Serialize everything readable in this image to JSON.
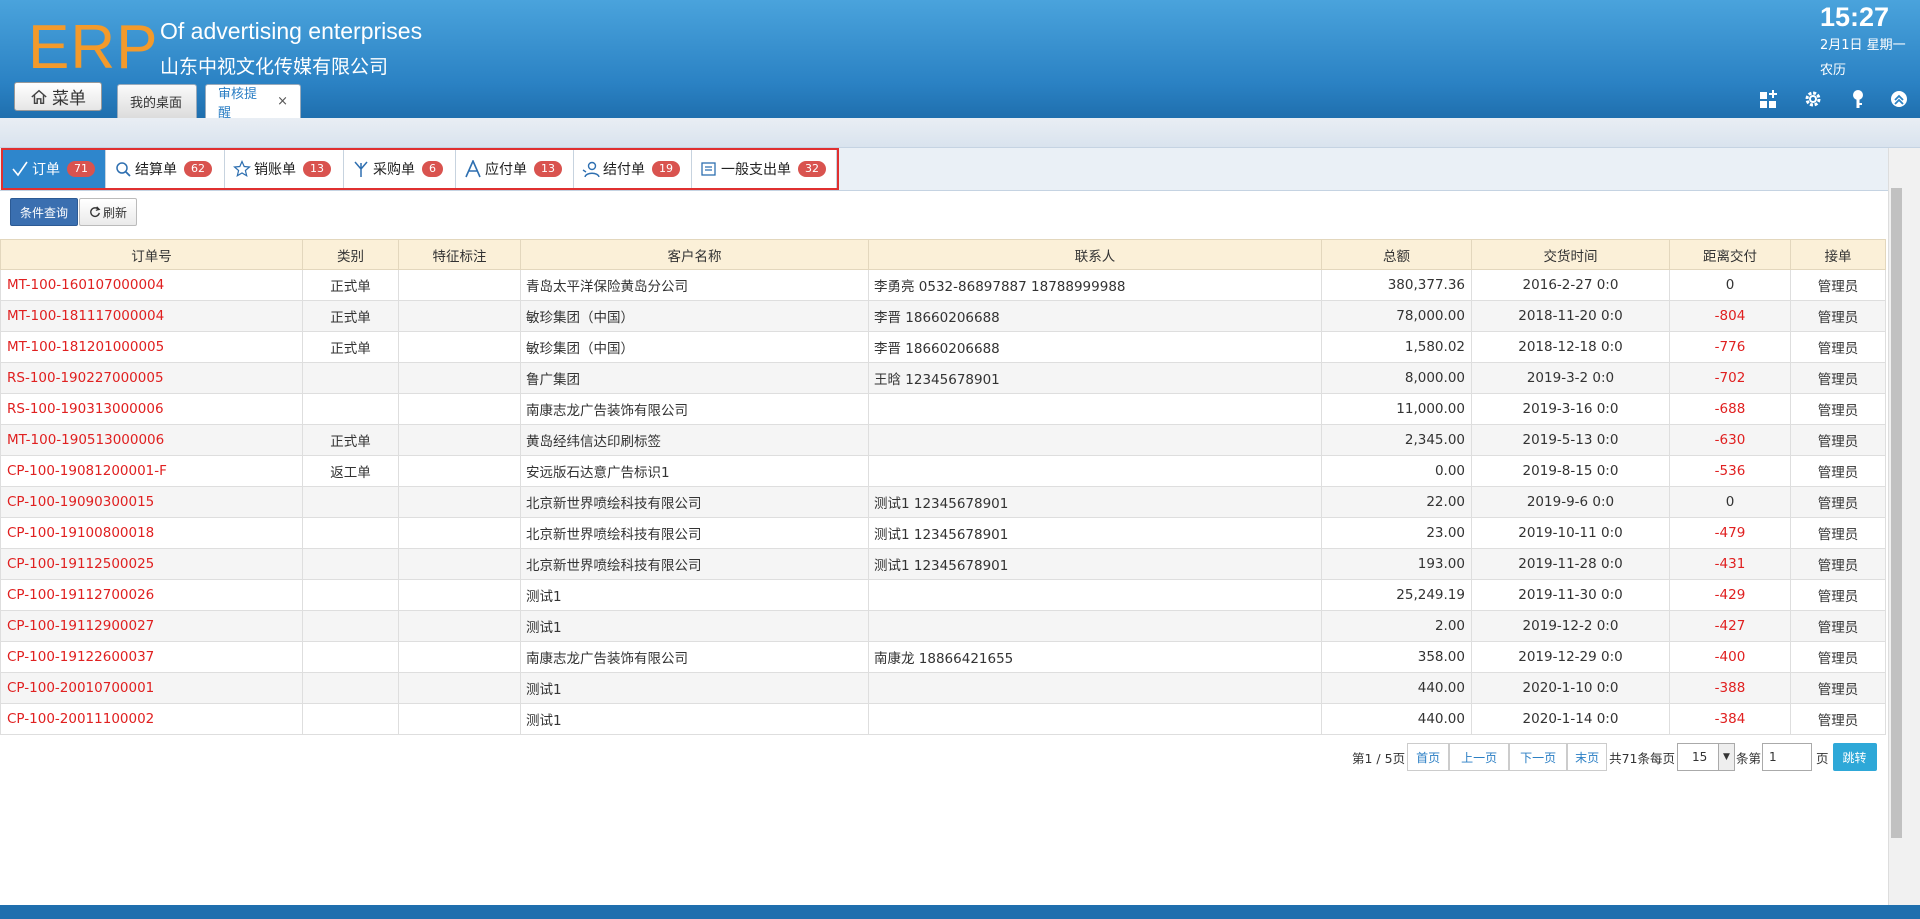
{
  "header": {
    "logo": "ERP",
    "brand_en": "Of advertising enterprises",
    "brand_cn": "山东中视文化传媒有限公司",
    "menu_label": "菜单",
    "tabs": [
      {
        "label": "我的桌面"
      },
      {
        "label": "审核提醒",
        "close": "×"
      }
    ],
    "clock": "15:27",
    "date": "2月1日 星期一",
    "lunar": "农历",
    "icons": [
      "grid-add-icon",
      "gear-icon",
      "key-icon",
      "collapse-up-icon"
    ]
  },
  "doc_tabs": [
    {
      "label": "订单",
      "count": "71",
      "icon": "check-icon",
      "active": true
    },
    {
      "label": "结算单",
      "count": "62",
      "icon": "search-icon"
    },
    {
      "label": "销账单",
      "count": "13",
      "icon": "star-icon"
    },
    {
      "label": "采购单",
      "count": "6",
      "icon": "fork-icon"
    },
    {
      "label": "应付单",
      "count": "13",
      "icon": "letter-a-icon"
    },
    {
      "label": "结付单",
      "count": "19",
      "icon": "person-icon"
    },
    {
      "label": "一般支出单",
      "count": "32",
      "icon": "document-icon"
    }
  ],
  "toolbar": {
    "query": "条件查询",
    "refresh": "刷新"
  },
  "table": {
    "columns": [
      "订单号",
      "类别",
      "特征标注",
      "客户名称",
      "联系人",
      "总额",
      "交货时间",
      "距离交付",
      "接单"
    ],
    "rows": [
      [
        "MT-100-160107000004",
        "正式单",
        "",
        "青岛太平洋保险黄岛分公司",
        "李勇亮 0532-86897887 18788999988",
        "380,377.36",
        "2016-2-27 0:0",
        "0",
        "管理员"
      ],
      [
        "MT-100-181117000004",
        "正式单",
        "",
        "敏珍集团（中国）",
        "李晋 18660206688",
        "78,000.00",
        "2018-11-20 0:0",
        "-804",
        "管理员"
      ],
      [
        "MT-100-181201000005",
        "正式单",
        "",
        "敏珍集团（中国）",
        "李晋 18660206688",
        "1,580.02",
        "2018-12-18 0:0",
        "-776",
        "管理员"
      ],
      [
        "RS-100-190227000005",
        "",
        "",
        "鲁广集团",
        "王晗 12345678901",
        "8,000.00",
        "2019-3-2 0:0",
        "-702",
        "管理员"
      ],
      [
        "RS-100-190313000006",
        "",
        "",
        "南康志龙广告装饰有限公司",
        "",
        "11,000.00",
        "2019-3-16 0:0",
        "-688",
        "管理员"
      ],
      [
        "MT-100-190513000006",
        "正式单",
        "",
        "黄岛经纬信达印刷标签",
        "",
        "2,345.00",
        "2019-5-13 0:0",
        "-630",
        "管理员"
      ],
      [
        "CP-100-19081200001-F",
        "返工单",
        "",
        "安远版石达意广告标识1",
        "",
        "0.00",
        "2019-8-15 0:0",
        "-536",
        "管理员"
      ],
      [
        "CP-100-19090300015",
        "",
        "",
        "北京新世界喷绘科技有限公司",
        "测试1 12345678901",
        "22.00",
        "2019-9-6 0:0",
        "0",
        "管理员"
      ],
      [
        "CP-100-19100800018",
        "",
        "",
        "北京新世界喷绘科技有限公司",
        "测试1 12345678901",
        "23.00",
        "2019-10-11 0:0",
        "-479",
        "管理员"
      ],
      [
        "CP-100-19112500025",
        "",
        "",
        "北京新世界喷绘科技有限公司",
        "测试1 12345678901",
        "193.00",
        "2019-11-28 0:0",
        "-431",
        "管理员"
      ],
      [
        "CP-100-19112700026",
        "",
        "",
        "测试1",
        "",
        "25,249.19",
        "2019-11-30 0:0",
        "-429",
        "管理员"
      ],
      [
        "CP-100-19112900027",
        "",
        "",
        "测试1",
        "",
        "2.00",
        "2019-12-2 0:0",
        "-427",
        "管理员"
      ],
      [
        "CP-100-19122600037",
        "",
        "",
        "南康志龙广告装饰有限公司",
        "南康龙 18866421655",
        "358.00",
        "2019-12-29 0:0",
        "-400",
        "管理员"
      ],
      [
        "CP-100-20010700001",
        "",
        "",
        "测试1",
        "",
        "440.00",
        "2020-1-10 0:0",
        "-388",
        "管理员"
      ],
      [
        "CP-100-20011100002",
        "",
        "",
        "测试1",
        "",
        "440.00",
        "2020-1-14 0:0",
        "-384",
        "管理员"
      ]
    ]
  },
  "pager": {
    "page_info": "第1 / 5页",
    "first": "首页",
    "prev": "上一页",
    "next": "下一页",
    "last": "末页",
    "total": "共71条每页",
    "per_page": "15",
    "goto_prefix": "条第",
    "goto_value": "1",
    "goto_suffix": "页",
    "go": "跳转"
  }
}
